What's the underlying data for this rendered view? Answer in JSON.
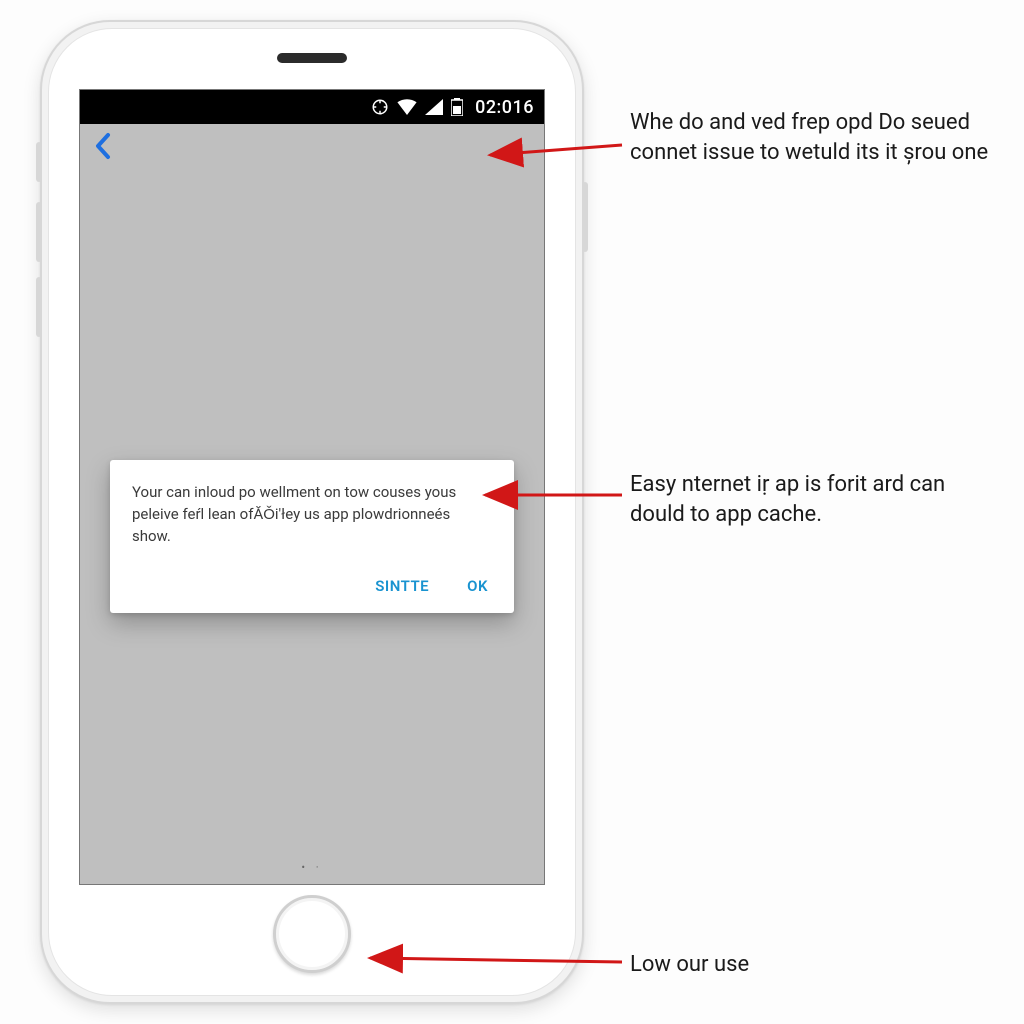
{
  "statusbar": {
    "clock": "02:016"
  },
  "dialog": {
    "message": "Your can inloud po wellment on tow couses yous peleive feŕl lean ofĂǑi'łey us app plowdrionneés show.",
    "secondary_label": "SINTTE",
    "primary_label": "OK"
  },
  "annotations": {
    "a1": "Whe do and ved frep opd Do seued connet issue to wetuld its it șrou one",
    "a2": "Easy nternet iṛ ap is forit ard can dould to app cache.",
    "a3": "Low our use"
  },
  "colors": {
    "accent": "#1993d0",
    "back": "#1e6fe0",
    "arrow": "#d11717"
  }
}
